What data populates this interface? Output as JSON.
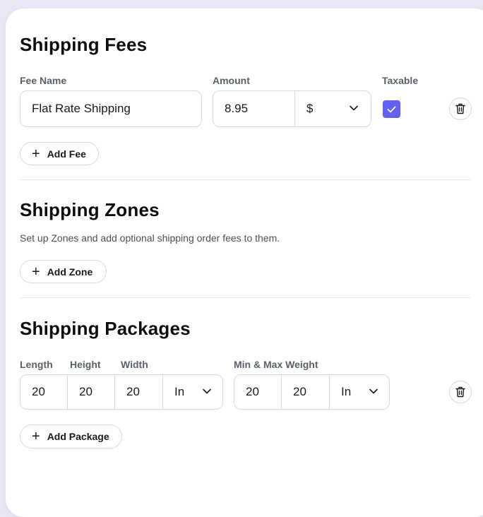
{
  "fees": {
    "title": "Shipping Fees",
    "labels": {
      "fee_name": "Fee Name",
      "amount": "Amount",
      "taxable": "Taxable"
    },
    "row": {
      "fee_name": "Flat Rate Shipping",
      "amount": "8.95",
      "currency": "$",
      "taxable": true
    },
    "add_button": "Add Fee"
  },
  "zones": {
    "title": "Shipping Zones",
    "description": "Set up Zones and add optional shipping order fees to them.",
    "add_button": "Add Zone"
  },
  "packages": {
    "title": "Shipping Packages",
    "labels": {
      "length": "Length",
      "height": "Height",
      "width": "Width",
      "weight": "Min & Max Weight"
    },
    "row": {
      "length": "20",
      "height": "20",
      "width": "20",
      "dim_unit": "In",
      "min_weight": "20",
      "max_weight": "20",
      "weight_unit": "In"
    },
    "add_button": "Add Package"
  },
  "colors": {
    "accent": "#6461f0",
    "border": "#d8dae0",
    "background": "#e9e7f6"
  },
  "icons": {
    "delete": "trash-icon",
    "add": "plus-icon",
    "dropdown": "chevron-down-icon",
    "check": "check-icon"
  }
}
